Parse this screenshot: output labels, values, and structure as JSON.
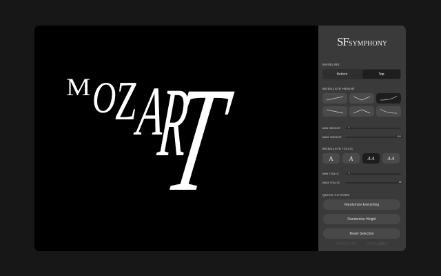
{
  "canvas": {
    "letters": [
      "M",
      "O",
      "Z",
      "A",
      "R",
      "T"
    ],
    "text_color": "#ffffff",
    "background": "#000000"
  },
  "panel": {
    "logo_big": "SF",
    "logo_small": "SYMPHONY",
    "baseline": {
      "label": "Baseline",
      "options": [
        "Bottom",
        "Top"
      ],
      "selected": "Top"
    },
    "modulate_height": {
      "label": "Modulate Height",
      "presets": [
        "linear-up",
        "peak-down",
        "ease-up",
        "linear-down",
        "valley-up",
        "ease-down"
      ],
      "selected_index": 2
    },
    "min_height": {
      "label": "Min Height",
      "value": "0",
      "fraction": 0.0
    },
    "max_height": {
      "label": "Max Height",
      "value": "100",
      "fraction": 1.0
    },
    "modulate_italic": {
      "label": "Modulate Italic",
      "presets": [
        "A",
        "A",
        "A A",
        "A A"
      ],
      "selected_index": 2
    },
    "min_italic": {
      "label": "Min Italic",
      "value": "0",
      "fraction": 0.0
    },
    "max_italic": {
      "label": "Max Italic",
      "value": "45",
      "fraction": 1.0
    },
    "quick_actions": {
      "label": "Quick Actions",
      "buttons": [
        "Randomize Everything",
        "Randomize Height",
        "Reset Selection"
      ]
    },
    "footer": [
      "ROOSTHO",
      "OFFLIMBO"
    ]
  },
  "colors": {
    "panel_bg": "#3a3a3a",
    "active_bg": "#1d1d1d",
    "button_bg": "#4a4a4a"
  }
}
